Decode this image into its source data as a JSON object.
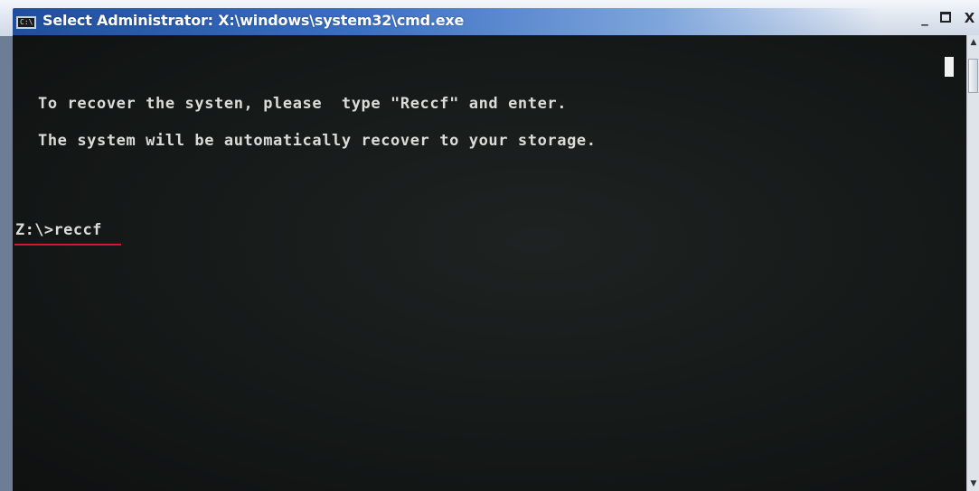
{
  "window": {
    "title": "Select Administrator: X:\\windows\\system32\\cmd.exe",
    "app_icon": "cmd-icon",
    "app_icon_glyph": "C:\\",
    "controls": {
      "minimize": "_",
      "close": "X"
    }
  },
  "console": {
    "lines": [
      "To recover the systen, please  type \"Reccf\" and enter.",
      "The system will be automatically recover to your storage."
    ],
    "prompt": "Z:\\>",
    "command": "reccf",
    "text_color": "#d9dcd8",
    "background_color": "#141817",
    "highlight_color": "#d3182a"
  },
  "scrollbar": {
    "up_arrow": "▲",
    "down_arrow": "▼"
  }
}
